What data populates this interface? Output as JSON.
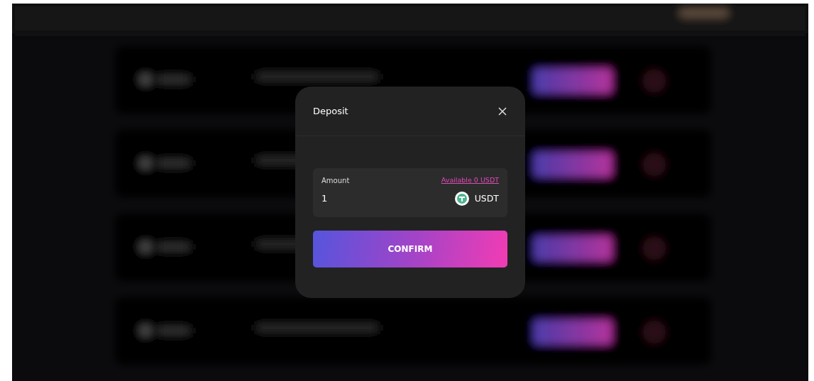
{
  "dialog": {
    "title": "Deposit",
    "amount": {
      "label": "Amount",
      "available": "Available 0 USDT",
      "value": "1",
      "currency": "USDT"
    },
    "confirm_button": "CONFIRM"
  },
  "background": {
    "kind": "blurred-page"
  }
}
